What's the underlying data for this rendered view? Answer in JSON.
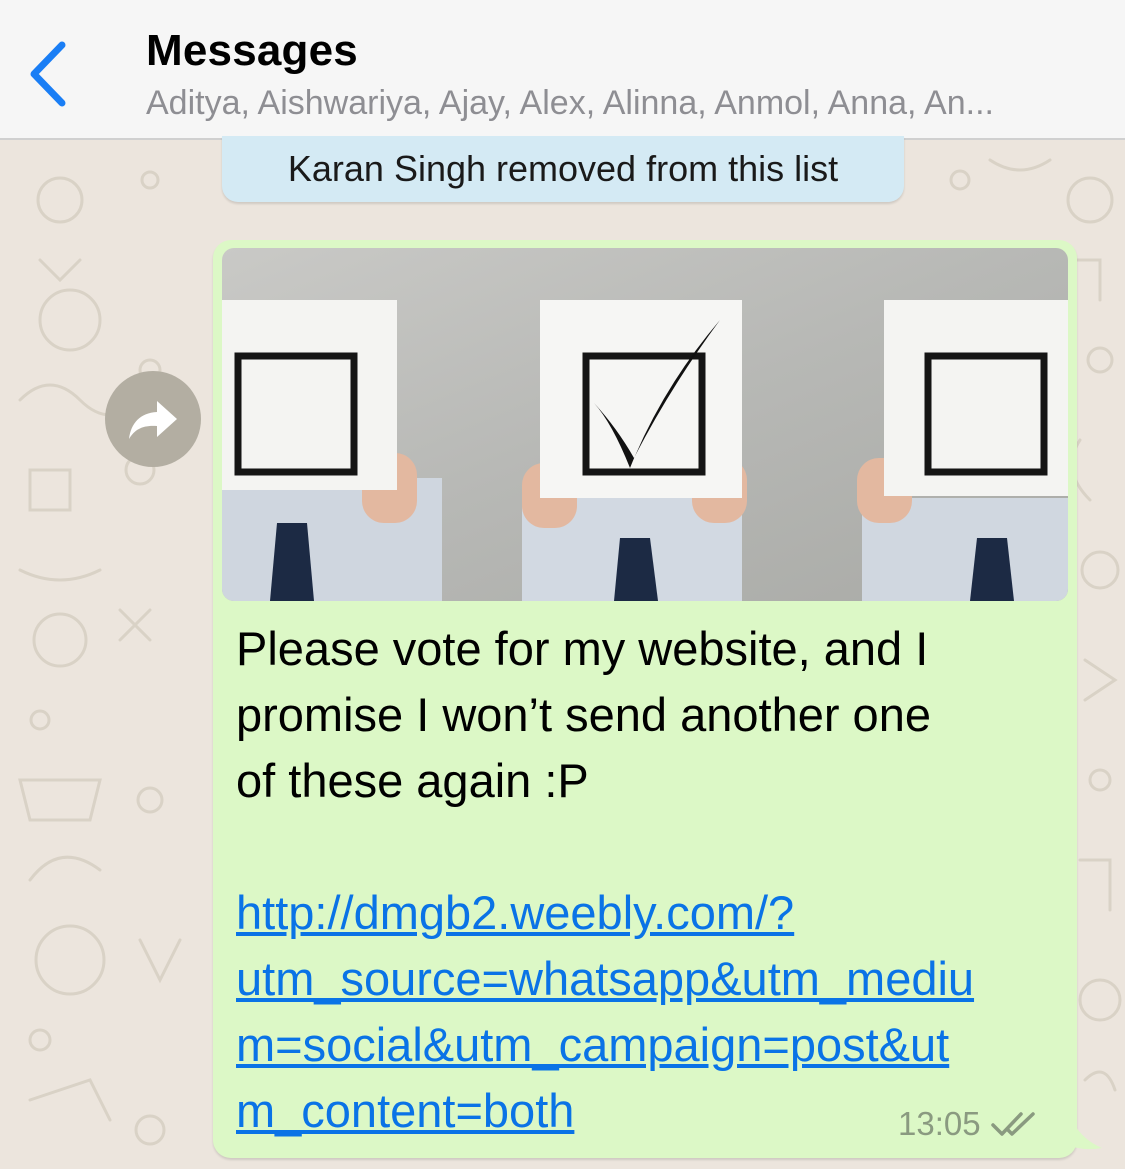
{
  "header": {
    "title": "Messages",
    "subtitle": "Aditya, Aishwariya, Ajay, Alex, Alinna, Anmol, Anna, An...",
    "back_icon": "chevron-left-icon"
  },
  "notice": {
    "text": "Karan Singh removed from this list"
  },
  "message": {
    "image_description": "three people holding cards with boxes, middle box checked",
    "text_lines": [
      "Please vote for my website, and I",
      "promise I won’t send another one",
      "of these again :P"
    ],
    "link_lines": [
      "http://dmgb2.weebly.com/?",
      "utm_source=whatsapp&utm_mediu",
      "m=social&utm_campaign=post&ut",
      "m_content=both"
    ],
    "time": "13:05",
    "status_icon": "double-check-icon"
  },
  "forward": {
    "icon": "forward-arrow-icon"
  },
  "colors": {
    "bubble": "#dcf8c6",
    "notice": "#d4eaf4",
    "accent": "#1a7ef5",
    "link": "#0a73e6",
    "wallpaper": "#ece5dd"
  }
}
